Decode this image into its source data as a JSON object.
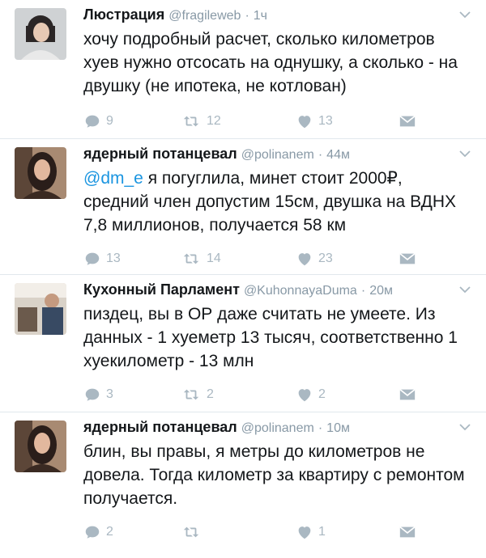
{
  "tweets": [
    {
      "name": "Люстрация",
      "handle": "@fragileweb",
      "separator": "·",
      "time": "1ч",
      "mention": "",
      "text": "хочу подробный расчет, сколько километров хуев нужно отсосать на однушку, а сколько - на двушку (не ипотека, не котлован)",
      "replies": "9",
      "retweets": "12",
      "likes": "13"
    },
    {
      "name": "ядерный потанцевал",
      "handle": "@polinanem",
      "separator": "·",
      "time": "44м",
      "mention": "@dm_e",
      "text": " я погуглила, минет стоит 2000₽, средний член допустим 15см, двушка на ВДНХ 7,8 миллионов, получается 58 км",
      "replies": "13",
      "retweets": "14",
      "likes": "23"
    },
    {
      "name": "Кухонный Парламент",
      "handle": "@KuhonnayaDuma",
      "separator": "·",
      "time": "20м",
      "mention": "",
      "text": "пиздец, вы в ОР даже считать не умеете. Из данных - 1 хуеметр 13 тысяч, соответственно 1 хуекилометр - 13 млн",
      "replies": "3",
      "retweets": "2",
      "likes": "2"
    },
    {
      "name": "ядерный потанцевал",
      "handle": "@polinanem",
      "separator": "·",
      "time": "10м",
      "mention": "",
      "text": "блин, вы правы, я метры до километров не довела. Тогда километр за квартиру с ремонтом получается.",
      "replies": "2",
      "retweets": "",
      "likes": "1"
    }
  ],
  "icons": {
    "reply": "reply-icon",
    "retweet": "retweet-icon",
    "like": "heart-icon",
    "dm": "envelope-icon",
    "more": "chevron-down-icon"
  },
  "colors": {
    "icon_gray": "#aab8c2",
    "mention_blue": "#1b95e0",
    "meta_gray": "#8899a6"
  }
}
